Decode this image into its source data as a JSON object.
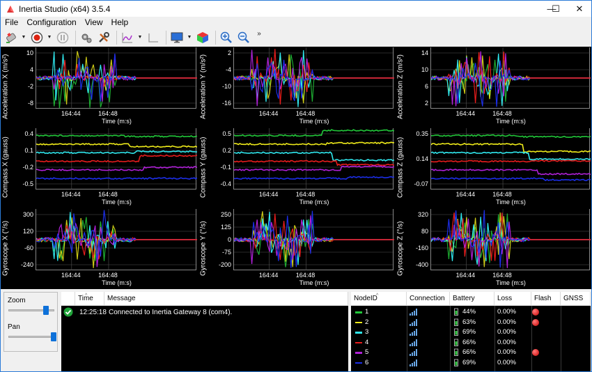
{
  "window": {
    "title": "Inertia Studio (x64) 3.5.4",
    "minimize": "—",
    "maximize": "☐",
    "close": "✕"
  },
  "menu": [
    "File",
    "Configuration",
    "View",
    "Help"
  ],
  "toolbar": {
    "overflow": "»"
  },
  "colors": {
    "node1": "#22c83a",
    "node2": "#f0ec1a",
    "node3": "#30e8ee",
    "node4": "#e81c1c",
    "node5": "#b021d8",
    "node6": "#1c2ee8",
    "redline": "#e81c1c"
  },
  "plots": [
    {
      "ylabel": "Acceleration X (m/s²)",
      "yticks": [
        "10",
        "4",
        "-2",
        "-8"
      ],
      "xticks": [
        "164:44",
        "164:48"
      ],
      "xlabel": "Time (m:s)"
    },
    {
      "ylabel": "Acceleration Y (m/s²)",
      "yticks": [
        "2",
        "-4",
        "-10",
        "-16"
      ],
      "xticks": [
        "164:44",
        "164:48"
      ],
      "xlabel": "Time (m:s)"
    },
    {
      "ylabel": "Acceleration Z (m/s²)",
      "yticks": [
        "14",
        "10",
        "6",
        "2"
      ],
      "xticks": [
        "164:44",
        "164:48"
      ],
      "xlabel": "Time (m:s)"
    },
    {
      "ylabel": "Compass X (gauss)",
      "yticks": [
        "0.4",
        "0.1",
        "-0.2",
        "-0.5"
      ],
      "xticks": [
        "164:44",
        "164:48"
      ],
      "xlabel": "Time (m:s)"
    },
    {
      "ylabel": "Compass Y (gauss)",
      "yticks": [
        "0.5",
        "0.2",
        "-0.1",
        "-0.4"
      ],
      "xticks": [
        "164:44",
        "164:48"
      ],
      "xlabel": "Time (m:s)"
    },
    {
      "ylabel": "Compass Z (gauss)",
      "yticks": [
        "0.35",
        "0.14",
        "-0.07"
      ],
      "xticks": [
        "164:44",
        "164:48"
      ],
      "xlabel": "Time (m:s)"
    },
    {
      "ylabel": "Gyroscope X (°/s)",
      "yticks": [
        "300",
        "120",
        "-60",
        "-240"
      ],
      "xticks": [
        "164:44",
        "164:48"
      ],
      "xlabel": "Time (m:s)"
    },
    {
      "ylabel": "Gyroscope Y (°/s)",
      "yticks": [
        "250",
        "125",
        "0",
        "-75",
        "-200"
      ],
      "xticks": [
        "164:44",
        "164:48"
      ],
      "xlabel": "Time (m:s)"
    },
    {
      "ylabel": "Gyroscope Z (°/s)",
      "yticks": [
        "320",
        "80",
        "-160",
        "-400"
      ],
      "xticks": [
        "164:44",
        "164:48"
      ],
      "xlabel": "Time (m:s)"
    }
  ],
  "controls": {
    "zoom_label": "Zoom",
    "pan_label": "Pan",
    "zoom_level": 0.8,
    "pan_level": 0.98
  },
  "log": {
    "headers": {
      "time": "Time",
      "message": "Message"
    },
    "rows": [
      {
        "time": "12:25:18",
        "message": "Connected to Inertia Gateway 8 (com4)."
      }
    ]
  },
  "nodes": {
    "headers": {
      "id": "NodeID",
      "connection": "Connection",
      "battery": "Battery",
      "loss": "Loss",
      "flash": "Flash",
      "gnss": "GNSS"
    },
    "rows": [
      {
        "id": "1",
        "battery": "44%",
        "loss": "0.00%",
        "flash": true,
        "color": "#22c83a"
      },
      {
        "id": "2",
        "battery": "63%",
        "loss": "0.00%",
        "flash": true,
        "color": "#f0ec1a"
      },
      {
        "id": "3",
        "battery": "69%",
        "loss": "0.00%",
        "flash": false,
        "color": "#30e8ee"
      },
      {
        "id": "4",
        "battery": "66%",
        "loss": "0.00%",
        "flash": false,
        "color": "#e81c1c"
      },
      {
        "id": "5",
        "battery": "66%",
        "loss": "0.00%",
        "flash": true,
        "color": "#b021d8"
      },
      {
        "id": "6",
        "battery": "69%",
        "loss": "0.00%",
        "flash": false,
        "color": "#1c2ee8"
      }
    ]
  }
}
